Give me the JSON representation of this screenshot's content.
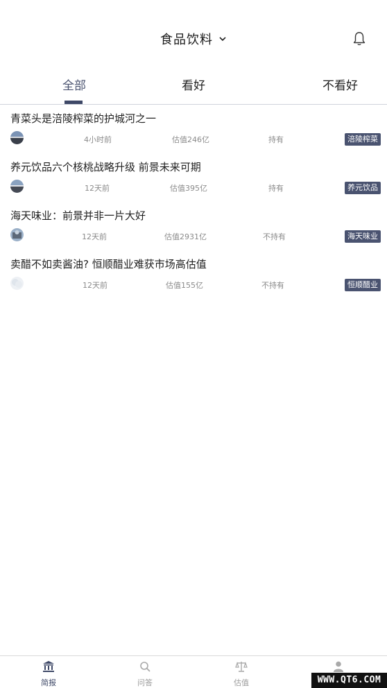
{
  "header": {
    "title": "食品饮料",
    "title_icon": "chevron-down-icon",
    "right_icon": "bell-icon"
  },
  "tabs": [
    {
      "label": "全部",
      "active": true
    },
    {
      "label": "看好",
      "active": false
    },
    {
      "label": "不看好",
      "active": false
    }
  ],
  "feed": [
    {
      "title": "青菜头是涪陵榨菜的护城河之一",
      "time": "4小时前",
      "valuation": "估值246亿",
      "holding": "持有",
      "tag": "涪陵榨菜"
    },
    {
      "title": "养元饮品六个核桃战略升级 前景未来可期",
      "time": "12天前",
      "valuation": "估值395亿",
      "holding": "持有",
      "tag": "养元饮品"
    },
    {
      "title": "海天味业：前景并非一片大好",
      "time": "12天前",
      "valuation": "估值2931亿",
      "holding": "不持有",
      "tag": "海天味业"
    },
    {
      "title": "卖醋不如卖酱油? 恒顺醋业难获市场高估值",
      "time": "12天前",
      "valuation": "估值155亿",
      "holding": "不持有",
      "tag": "恒顺醋业"
    }
  ],
  "bottom_nav": [
    {
      "label": "简报",
      "icon": "bank-icon",
      "active": true
    },
    {
      "label": "问答",
      "icon": "qa-icon",
      "active": false
    },
    {
      "label": "估值",
      "icon": "scale-icon",
      "active": false
    },
    {
      "label": "",
      "icon": "user-icon",
      "active": false
    }
  ],
  "watermark": "WWW.QT6.COM",
  "colors": {
    "accent": "#4a5370",
    "underline": "#3e4867",
    "meta_text": "#8a8a8a"
  }
}
